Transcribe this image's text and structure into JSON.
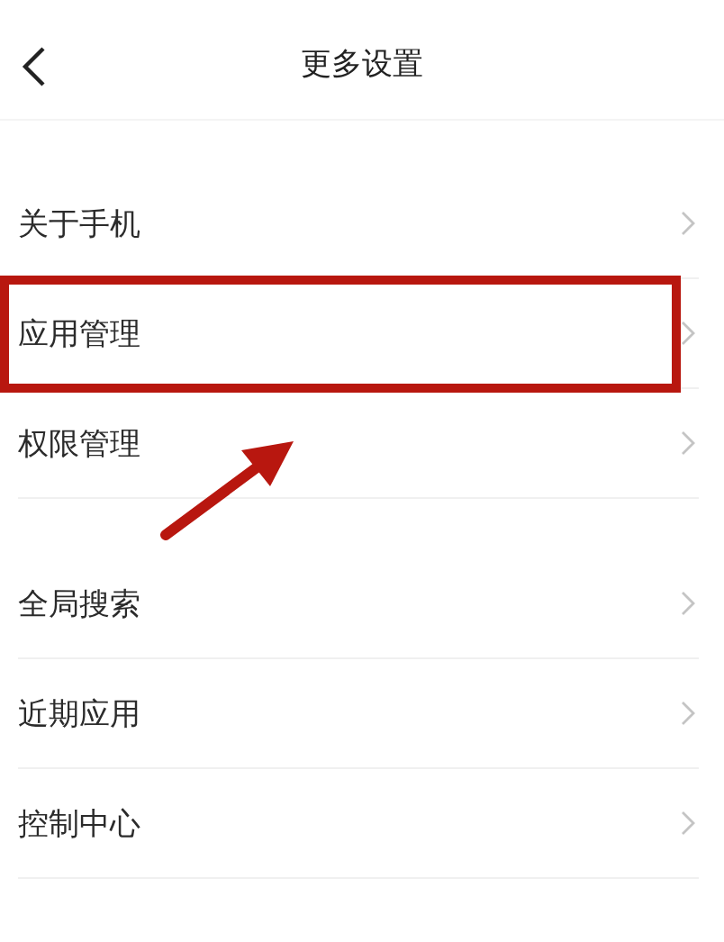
{
  "header": {
    "title": "更多设置"
  },
  "groups": [
    {
      "items": [
        {
          "label": "关于手机",
          "highlighted": false
        },
        {
          "label": "应用管理",
          "highlighted": true
        },
        {
          "label": "权限管理",
          "highlighted": false
        }
      ]
    },
    {
      "items": [
        {
          "label": "全局搜索",
          "highlighted": false
        },
        {
          "label": "近期应用",
          "highlighted": false
        },
        {
          "label": "控制中心",
          "highlighted": false
        }
      ]
    }
  ]
}
